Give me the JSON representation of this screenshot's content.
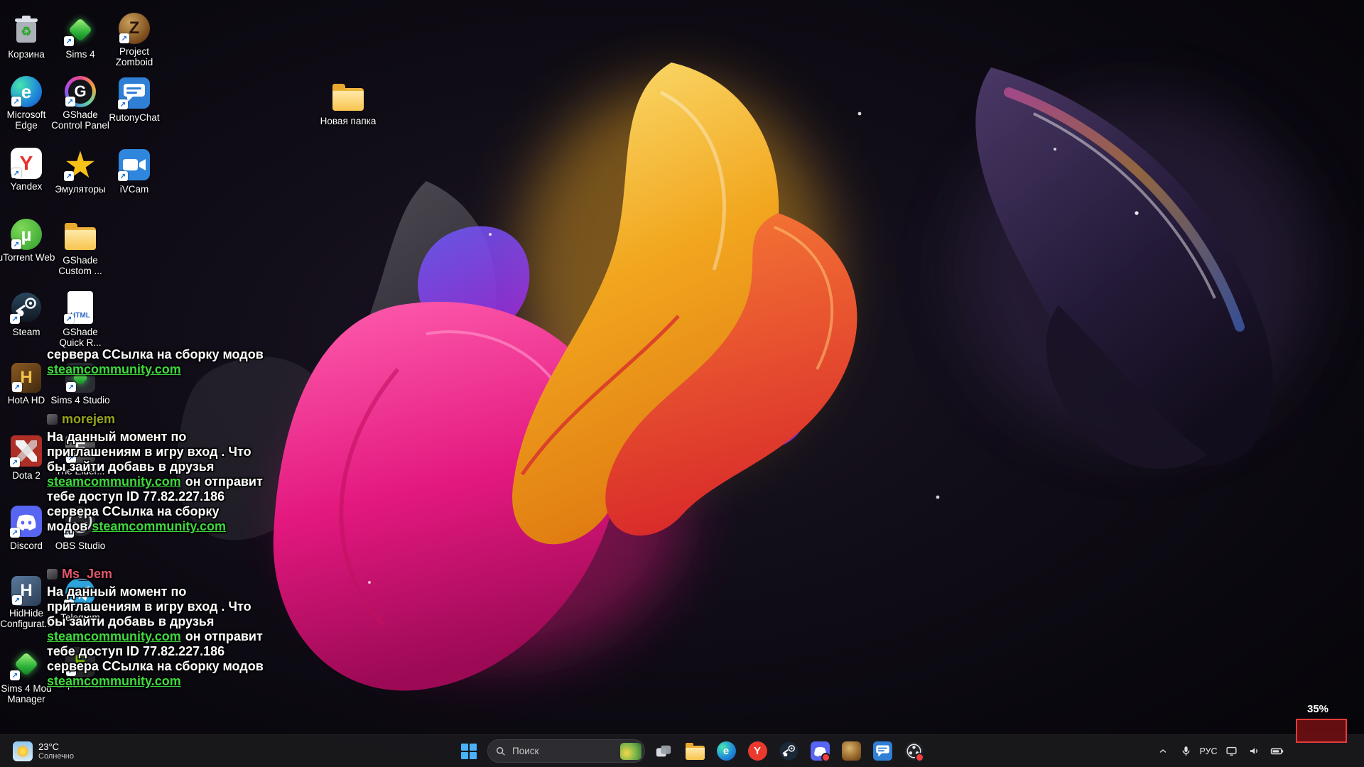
{
  "wallpaper": {
    "background": "#0d0a13",
    "accents": [
      "#f2a71f",
      "#e3187f",
      "#e03527",
      "#4a3866",
      "#6a5cff"
    ]
  },
  "glyphs": {
    "recycle": "♻",
    "edge": "e",
    "yandex": "Y",
    "utorrent": "µ",
    "star": "★",
    "gshade": "G",
    "hota": "H",
    "hidhide": "H",
    "elder": "E",
    "experience": "E",
    "zomboid": "Z",
    "html": "HTML"
  },
  "desktop": {
    "icons": [
      {
        "name": "recycle-bin",
        "label": "Корзина"
      },
      {
        "name": "sims-4",
        "label": "Sims 4"
      },
      {
        "name": "project-zomboid",
        "label": "Project Zomboid"
      },
      {
        "name": "microsoft-edge",
        "label": "Microsoft Edge"
      },
      {
        "name": "gshade-control-panel",
        "label": "GShade Control Panel"
      },
      {
        "name": "rutonychat",
        "label": "RutonyChat"
      },
      {
        "name": "yandex",
        "label": "Yandex"
      },
      {
        "name": "emulators",
        "label": "Эмуляторы"
      },
      {
        "name": "ivcam",
        "label": "iVCam"
      },
      {
        "name": "utorrent-web",
        "label": "uTorrent Web"
      },
      {
        "name": "gshade-custom",
        "label": "GShade Custom ..."
      },
      {
        "name": "steam",
        "label": "Steam"
      },
      {
        "name": "gshade-quick",
        "label": "GShade Quick R..."
      },
      {
        "name": "hota-hd",
        "label": "HotA HD"
      },
      {
        "name": "sims-4-studio",
        "label": "Sims 4 Studio"
      },
      {
        "name": "dota-2",
        "label": "Dota 2"
      },
      {
        "name": "the-elder",
        "label": "The Elder..."
      },
      {
        "name": "discord",
        "label": "Discord"
      },
      {
        "name": "obs-studio",
        "label": "OBS Studio"
      },
      {
        "name": "hidhide",
        "label": "HidHide Configurat..."
      },
      {
        "name": "telegram",
        "label": "Telegram"
      },
      {
        "name": "sims-4-mod-manager",
        "label": "Sims 4 Mod Manager"
      },
      {
        "name": "experience",
        "label": "Experience"
      },
      {
        "name": "new-folder",
        "label": "Новая папка"
      }
    ]
  },
  "chat": {
    "partial": {
      "line1": "сервера ССылка на сборку модов",
      "link": "steamcommunity.com"
    },
    "messages": [
      {
        "username": "morejem",
        "l1": "На данный момент по",
        "l2": "приглашениям в игру вход . Что",
        "l3": "бы зайти добавь в друзья",
        "link1": "steamcommunity.com",
        "l4": "он отправит",
        "l5": "тебе доступ ID 77.82.227.186",
        "l6": "сервера ССылка на сборку",
        "l7": "модов",
        "link2": "steamcommunity.com"
      },
      {
        "username": "Ms_Jem",
        "l1": "На данный момент по",
        "l2": "приглашениям в игру вход . Что",
        "l3": "бы зайти добавь в друзья",
        "link1": "steamcommunity.com",
        "l4": "он отправит",
        "l5": "тебе доступ ID 77.82.227.186",
        "l6": "сервера ССылка на сборку модов",
        "link2": "steamcommunity.com"
      }
    ],
    "colors": {
      "link": "#3fd83f",
      "username_morejem": "#9aa41e",
      "username_msjem": "#e0566e"
    }
  },
  "weather": {
    "temperature": "23°C",
    "condition": "Солнечно"
  },
  "taskbar": {
    "search": {
      "placeholder": "Поиск",
      "icon": "search-icon"
    },
    "language": "РУС",
    "pinned": [
      "start",
      "task-view",
      "file-explorer",
      "microsoft-edge",
      "yandex-browser",
      "steam",
      "discord",
      "game",
      "rutonychat",
      "obs-studio"
    ],
    "tray": [
      "hidden-icons-chevron",
      "microphone",
      "language",
      "monitor",
      "volume",
      "battery"
    ]
  },
  "overlay": {
    "capture_percent": "35%"
  }
}
